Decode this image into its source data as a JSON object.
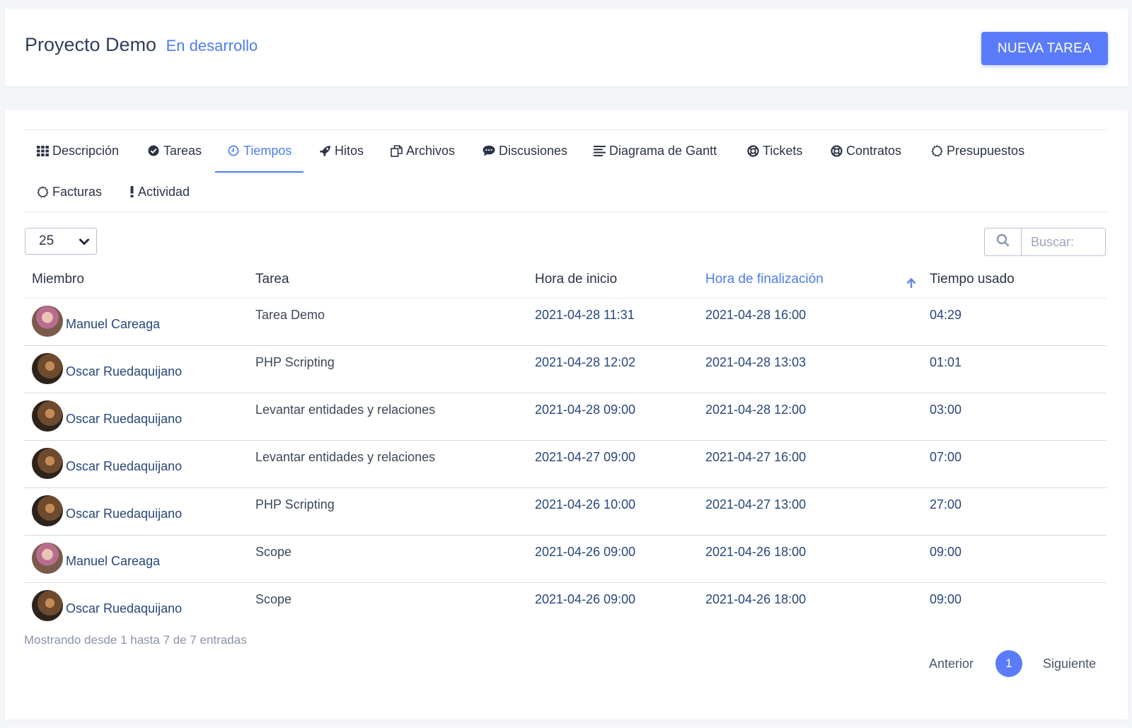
{
  "header": {
    "project_name": "Proyecto Demo",
    "status": "En desarrollo",
    "new_task_label": "NUEVA TAREA"
  },
  "tabs": [
    {
      "label": "Descripción",
      "icon": "grid-icon"
    },
    {
      "label": "Tareas",
      "icon": "check-circle-icon"
    },
    {
      "label": "Tiempos",
      "icon": "clock-icon",
      "active": true
    },
    {
      "label": "Hitos",
      "icon": "rocket-icon"
    },
    {
      "label": "Archivos",
      "icon": "files-icon"
    },
    {
      "label": "Discusiones",
      "icon": "chat-icon"
    },
    {
      "label": "Diagrama de Gantt",
      "icon": "list-icon"
    },
    {
      "label": "Tickets",
      "icon": "lifebuoy-icon"
    },
    {
      "label": "Contratos",
      "icon": "lifebuoy-icon"
    },
    {
      "label": "Presupuestos",
      "icon": "gear-icon"
    },
    {
      "label": "Facturas",
      "icon": "gear-icon"
    },
    {
      "label": "Actividad",
      "icon": "exclamation-icon"
    }
  ],
  "controls": {
    "page_length": "25",
    "search_placeholder": "Buscar:"
  },
  "table": {
    "columns": [
      "Miembro",
      "Tarea",
      "Hora de inicio",
      "Hora de finalización",
      "Tiempo usado"
    ],
    "sorted_column": "Hora de finalización",
    "rows": [
      {
        "member": "Manuel Careaga",
        "avatar": "manuel",
        "task": "Tarea Demo",
        "start": "2021-04-28 11:31",
        "end": "2021-04-28 16:00",
        "used": "04:29"
      },
      {
        "member": "Oscar Ruedaquijano",
        "avatar": "oscar",
        "task": "PHP Scripting",
        "start": "2021-04-28 12:02",
        "end": "2021-04-28 13:03",
        "used": "01:01"
      },
      {
        "member": "Oscar Ruedaquijano",
        "avatar": "oscar",
        "task": "Levantar entidades y relaciones",
        "start": "2021-04-28 09:00",
        "end": "2021-04-28 12:00",
        "used": "03:00"
      },
      {
        "member": "Oscar Ruedaquijano",
        "avatar": "oscar",
        "task": "Levantar entidades y relaciones",
        "start": "2021-04-27 09:00",
        "end": "2021-04-27 16:00",
        "used": "07:00"
      },
      {
        "member": "Oscar Ruedaquijano",
        "avatar": "oscar",
        "task": "PHP Scripting",
        "start": "2021-04-26 10:00",
        "end": "2021-04-27 13:00",
        "used": "27:00"
      },
      {
        "member": "Manuel Careaga",
        "avatar": "manuel",
        "task": "Scope",
        "start": "2021-04-26 09:00",
        "end": "2021-04-26 18:00",
        "used": "09:00"
      },
      {
        "member": "Oscar Ruedaquijano",
        "avatar": "oscar",
        "task": "Scope",
        "start": "2021-04-26 09:00",
        "end": "2021-04-26 18:00",
        "used": "09:00"
      }
    ]
  },
  "footer": {
    "info": "Mostrando desde 1 hasta 7 de 7 entradas",
    "prev_label": "Anterior",
    "current_page": "1",
    "next_label": "Siguiente"
  },
  "colors": {
    "accent": "#5b7cfa",
    "link": "#27477a",
    "active_tab": "#4f7cf0"
  }
}
